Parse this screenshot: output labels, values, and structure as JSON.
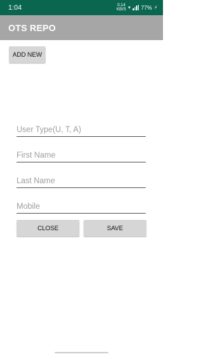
{
  "status_bar": {
    "time": "1:04",
    "network_speed_value": "0.14",
    "network_speed_unit": "KB/S",
    "battery": "77%"
  },
  "app_bar": {
    "title": "OTS REPO"
  },
  "buttons": {
    "add_new": "ADD NEW",
    "close": "CLOSE",
    "save": "SAVE"
  },
  "form": {
    "user_type_placeholder": "User Type(U, T, A)",
    "first_name_placeholder": "First Name",
    "last_name_placeholder": "Last Name",
    "mobile_placeholder": "Mobile"
  },
  "colors": {
    "status_bar": "#0b6650",
    "app_bar": "#a6a6a6",
    "button": "#d6d6d6"
  }
}
